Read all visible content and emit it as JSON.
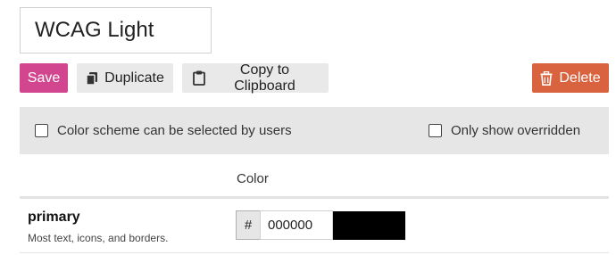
{
  "scheme": {
    "name": "WCAG Light"
  },
  "toolbar": {
    "save_label": "Save",
    "duplicate_label": "Duplicate",
    "copy_label": "Copy to Clipboard",
    "delete_label": "Delete"
  },
  "options": {
    "user_selectable_label": "Color scheme can be selected by users",
    "user_selectable_checked": false,
    "only_overridden_label": "Only show overridden",
    "only_overridden_checked": false
  },
  "table": {
    "color_header": "Color"
  },
  "colors": [
    {
      "name": "primary",
      "description": "Most text, icons, and borders.",
      "hash": "#",
      "hex": "000000",
      "swatch": "#000000"
    }
  ],
  "theme": {
    "save": "#d1468f",
    "delete": "#d9623f",
    "button_bg": "#e9e9e9",
    "options_bg": "#e6e6e6"
  },
  "icons": {
    "duplicate": "copy-icon",
    "copy": "clipboard-icon",
    "delete": "trash-icon"
  }
}
